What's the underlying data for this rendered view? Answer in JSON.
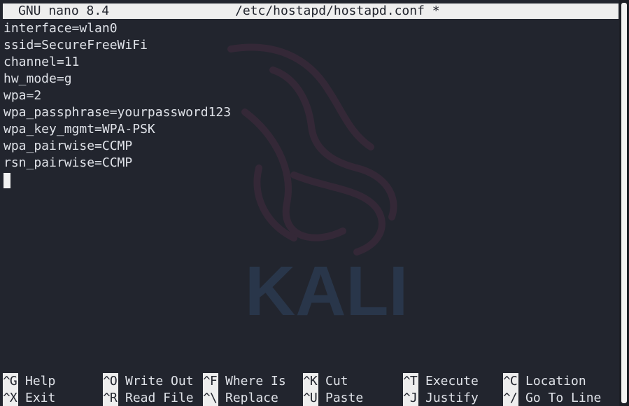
{
  "titlebar": {
    "app": "GNU nano 8.4",
    "file": "/etc/hostapd/hostapd.conf *"
  },
  "editor": {
    "lines": [
      "interface=wlan0",
      "ssid=SecureFreeWiFi",
      "channel=11",
      "hw_mode=g",
      "wpa=2",
      "wpa_passphrase=yourpassword123",
      "wpa_key_mgmt=WPA-PSK",
      "wpa_pairwise=CCMP",
      "rsn_pairwise=CCMP"
    ]
  },
  "watermark": {
    "text": "KALI",
    "icon": "kali-dragon-icon",
    "color": "#2b3a4f"
  },
  "shortcuts": {
    "row1": [
      {
        "key": "^G",
        "label": "Help"
      },
      {
        "key": "^O",
        "label": "Write Out"
      },
      {
        "key": "^F",
        "label": "Where Is"
      },
      {
        "key": "^K",
        "label": "Cut"
      },
      {
        "key": "^T",
        "label": "Execute"
      },
      {
        "key": "^C",
        "label": "Location"
      }
    ],
    "row2": [
      {
        "key": "^X",
        "label": "Exit"
      },
      {
        "key": "^R",
        "label": "Read File"
      },
      {
        "key": "^\\",
        "label": "Replace"
      },
      {
        "key": "^U",
        "label": "Paste"
      },
      {
        "key": "^J",
        "label": "Justify"
      },
      {
        "key": "^/",
        "label": "Go To Line"
      }
    ]
  },
  "colors": {
    "background": "#22252e",
    "text": "#dfe2e8",
    "inverse_bg": "#eeeeee"
  }
}
